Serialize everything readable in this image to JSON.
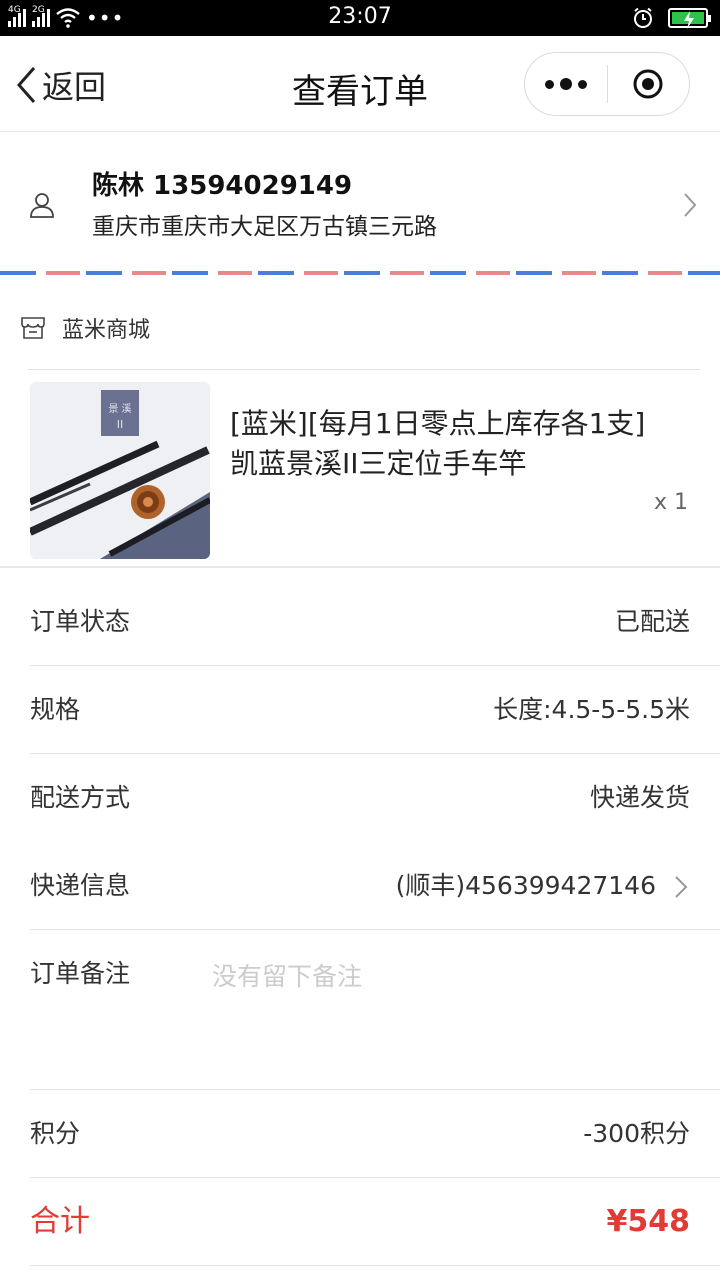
{
  "status_bar": {
    "network_1": "4G",
    "network_2": "2G",
    "more_dots": "•••",
    "time": "23:07"
  },
  "navbar": {
    "back_label": "返回",
    "title": "查看订单"
  },
  "address": {
    "name_phone": "陈林 13594029149",
    "detail": "重庆市重庆市大足区万古镇三元路"
  },
  "shop": {
    "name": "蓝米商城"
  },
  "product": {
    "title": "[蓝米][每月1日零点上库存各1支]凯蓝景溪II三定位手车竿",
    "quantity": "x 1"
  },
  "order": {
    "status_label": "订单状态",
    "status_value": "已配送",
    "spec_label": "规格",
    "spec_value": "长度:4.5-5-5.5米",
    "delivery_label": "配送方式",
    "delivery_value": "快递发货",
    "express_label": "快递信息",
    "express_value": "(顺丰)456399427146",
    "remark_label": "订单备注",
    "remark_placeholder": "没有留下备注",
    "points_label": "积分",
    "points_value": "-300积分",
    "total_label": "合计",
    "total_value": "¥548"
  },
  "colors": {
    "accent_red": "#e23b35",
    "airmail_blue": "#4a7ed6",
    "airmail_red": "#e58a8a",
    "battery_green": "#2ec14b"
  }
}
